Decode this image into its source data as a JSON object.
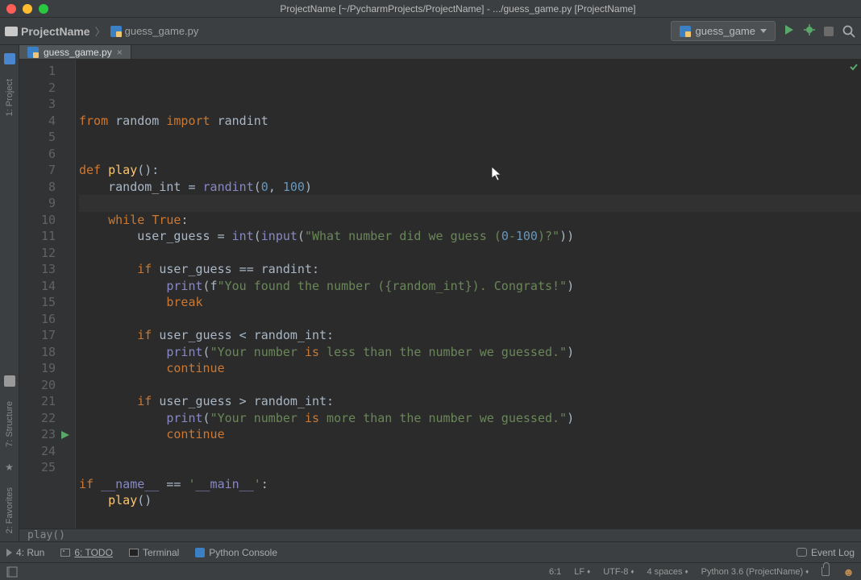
{
  "window": {
    "title": "ProjectName [~/PycharmProjects/ProjectName] - .../guess_game.py [ProjectName]"
  },
  "toolbar": {
    "breadcrumb": {
      "project": "ProjectName",
      "file": "guess_game.py"
    },
    "run_config": "guess_game"
  },
  "left_rail": {
    "project": "1: Project",
    "structure": "7: Structure",
    "favorites": "2: Favorites"
  },
  "tab": {
    "name": "guess_game.py"
  },
  "code": {
    "lines": [
      "from random import randint",
      "",
      "",
      "def play():",
      "    random_int = randint(0, 100)",
      "",
      "    while True:",
      "        user_guess = int(input(\"What number did we guess (0-100)?\"))",
      "",
      "        if user_guess == randint:",
      "            print(f\"You found the number ({random_int}). Congrats!\")",
      "            break",
      "",
      "        if user_guess < random_int:",
      "            print(\"Your number is less than the number we guessed.\")",
      "            continue",
      "",
      "        if user_guess > random_int:",
      "            print(\"Your number is more than the number we guessed.\")",
      "            continue",
      "",
      "",
      "if __name__ == '__main__':",
      "    play()",
      ""
    ]
  },
  "editor_crumb": "play()",
  "bottom_tools": {
    "run": "4: Run",
    "todo": "6: TODO",
    "terminal": "Terminal",
    "python_console": "Python Console",
    "event_log": "Event Log"
  },
  "status": {
    "position": "6:1",
    "line_sep": "LF",
    "encoding": "UTF-8",
    "indent": "4 spaces",
    "interpreter": "Python 3.6 (ProjectName)"
  }
}
